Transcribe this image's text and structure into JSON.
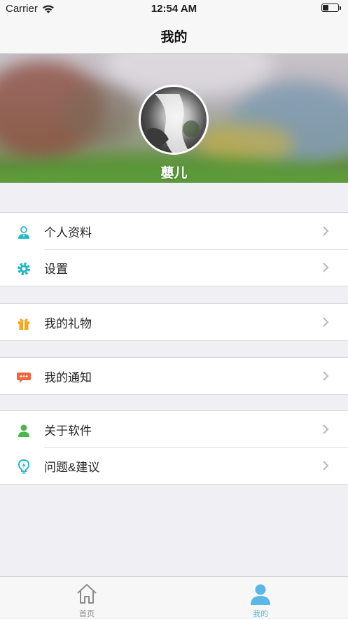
{
  "status_bar": {
    "carrier": "Carrier",
    "time": "12:54 AM",
    "battery_level": 0.35
  },
  "nav": {
    "title": "我的"
  },
  "profile": {
    "username": "蘡儿"
  },
  "menu": {
    "profile_label": "个人资料",
    "settings_label": "设置",
    "gifts_label": "我的礼物",
    "notifications_label": "我的通知",
    "about_label": "关于软件",
    "feedback_label": "问题&建议"
  },
  "tabs": {
    "home_label": "首页",
    "mine_label": "我的"
  },
  "colors": {
    "accent": "#5bb8e6",
    "teal_icon": "#26b8c8",
    "gift_icon": "#f5a623",
    "notice_icon": "#f0643c",
    "about_icon": "#4cb648",
    "tab_inactive": "#8a8a8a"
  },
  "icons": {
    "profile": "person-card-icon",
    "settings": "gear-icon",
    "gifts": "gift-icon",
    "notifications": "chat-bubble-icon",
    "about": "person-icon",
    "feedback": "lightbulb-icon",
    "home_tab": "house-icon",
    "mine_tab": "user-icon"
  }
}
